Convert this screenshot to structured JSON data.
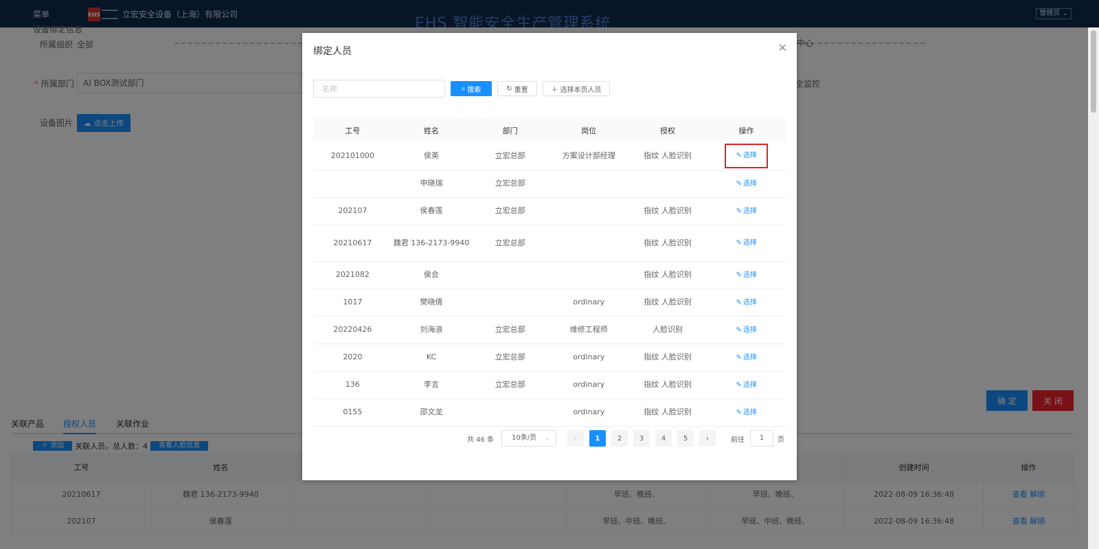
{
  "app": {
    "menu_label": "菜单",
    "company": "立宏安全设备（上海）有限公司",
    "system_title": "EHS 智能安全生产管理系统",
    "user_label": "管理员"
  },
  "background_form": {
    "section_label": "设备绑定信息",
    "org_label": "所属组织",
    "org_value": "全部",
    "dept_label": "所属部门",
    "dept_value": "AI BOX测试部门",
    "image_label": "设备图片",
    "upload_label": "点击上传",
    "right_text_1": "中心",
    "right_text_2": "全监控",
    "ok_label": "确 定",
    "close_label": "关 闭"
  },
  "background_tabs": [
    "关联产品",
    "授权人员",
    "关联作业"
  ],
  "background_actions": {
    "add_label": "添加",
    "summary": "关联人员，总人数：4",
    "view_label": "查看人脸信息"
  },
  "background_table": {
    "headers": [
      "工号",
      "姓名",
      "",
      "",
      "",
      "",
      "创建时间",
      "操作"
    ],
    "rows": [
      [
        "20210617",
        "魏君 136-2173-9940",
        "",
        "",
        "早班、晚班、",
        "早班、晚班、",
        "2022-08-09 16:36:48",
        "查看 解绑"
      ],
      [
        "202107",
        "侯春莲",
        "",
        "",
        "早班、中班、晚班、",
        "早班、中班、晚班、",
        "2022-08-09 16:36:48",
        "查看 解绑"
      ]
    ]
  },
  "dialog": {
    "title": "绑定人员",
    "search_placeholder": "名称",
    "search_label": "搜索",
    "reset_label": "重置",
    "select_page_label": "选择本页人员",
    "columns": [
      "工号",
      "姓名",
      "部门",
      "岗位",
      "授权",
      "操作"
    ],
    "action_label": "选择",
    "rows": [
      {
        "id": "202101000",
        "name": "侯英",
        "dept": "立宏总部",
        "post": "方案设计部经理",
        "auth": "指纹 人脸识别"
      },
      {
        "id": "",
        "name": "申晓瑞",
        "dept": "立宏总部",
        "post": "",
        "auth": ""
      },
      {
        "id": "202107",
        "name": "侯春莲",
        "dept": "立宏总部",
        "post": "",
        "auth": "指纹 人脸识别"
      },
      {
        "id": "20210617",
        "name": "魏君 136-2173-9940",
        "dept": "立宏总部",
        "post": "",
        "auth": "指纹 人脸识别"
      },
      {
        "id": "2021082",
        "name": "侯会",
        "dept": "",
        "post": "",
        "auth": "指纹 人脸识别"
      },
      {
        "id": "1017",
        "name": "樊晓倩",
        "dept": "",
        "post": "ordinary",
        "auth": "指纹 人脸识别"
      },
      {
        "id": "20220426",
        "name": "刘海浪",
        "dept": "立宏总部",
        "post": "维修工程师",
        "auth": "人脸识别"
      },
      {
        "id": "2020",
        "name": "KC",
        "dept": "立宏总部",
        "post": "ordinary",
        "auth": "指纹 人脸识别"
      },
      {
        "id": "136",
        "name": "李言",
        "dept": "立宏总部",
        "post": "ordinary",
        "auth": "指纹 人脸识别"
      },
      {
        "id": "0155",
        "name": "邵文龙",
        "dept": "",
        "post": "ordinary",
        "auth": "指纹 人脸识别"
      }
    ],
    "pagination": {
      "total_label": "共 46 条",
      "page_size": "10条/页",
      "pages": [
        "1",
        "2",
        "3",
        "4",
        "5"
      ],
      "current_page": "1",
      "goto_label": "前往",
      "goto_value": "1",
      "page_unit": "页"
    }
  },
  "colors": {
    "primary": "#1890ff",
    "danger": "#f5222d",
    "header_bg": "#0e2a4d",
    "highlight_box": "#e02020"
  }
}
